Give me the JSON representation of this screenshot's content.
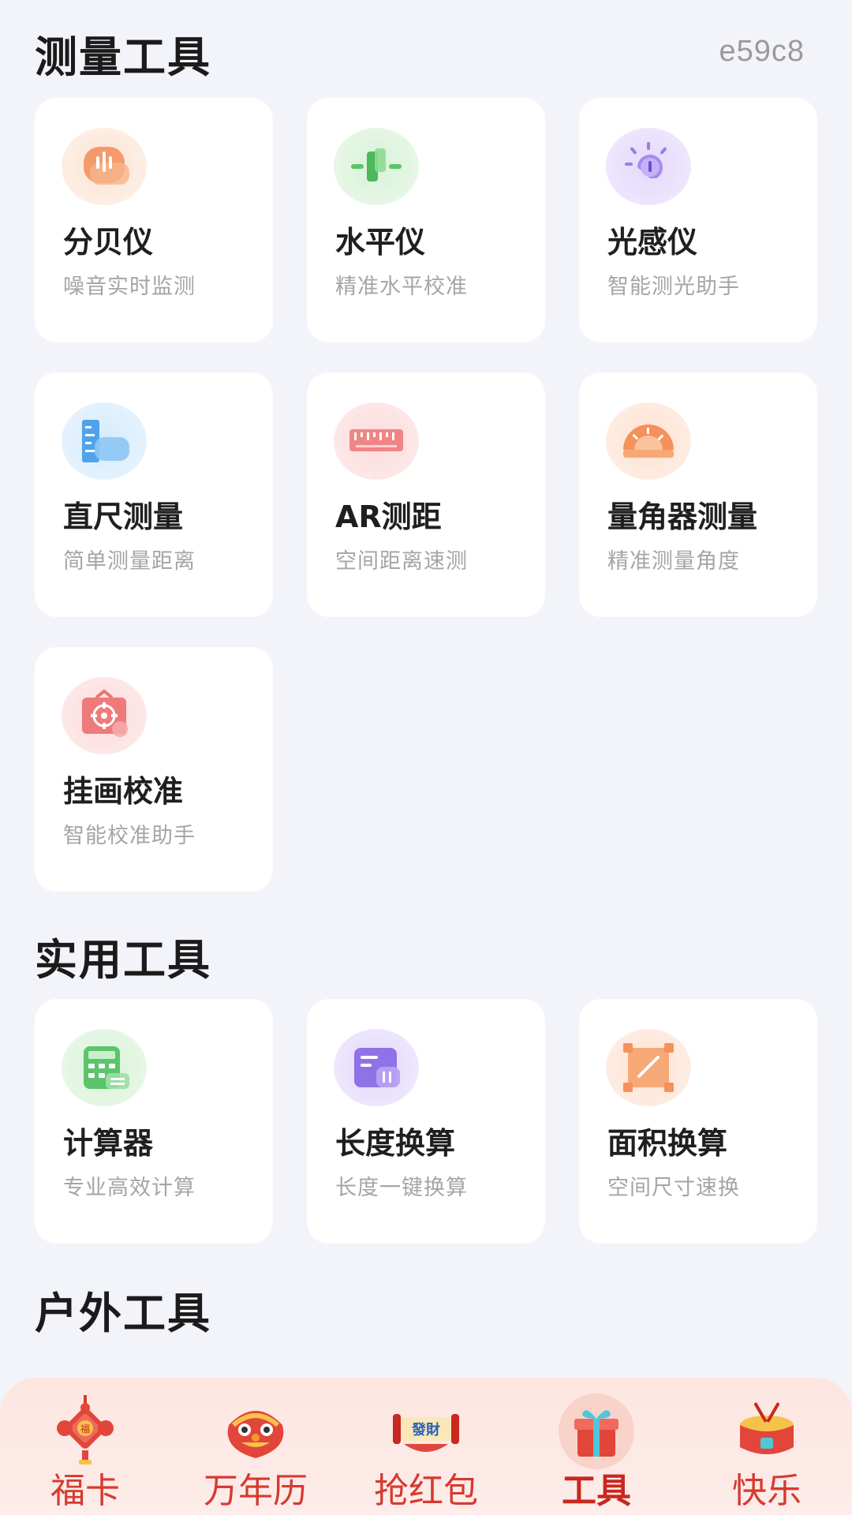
{
  "corner_code": "e59c8",
  "sections": {
    "measure": {
      "title": "测量工具",
      "cards": [
        {
          "name": "分贝仪",
          "desc": "噪音实时监测",
          "icon": "decibel-meter-icon"
        },
        {
          "name": "水平仪",
          "desc": "精准水平校准",
          "icon": "level-icon"
        },
        {
          "name": "光感仪",
          "desc": "智能测光助手",
          "icon": "light-sensor-icon"
        },
        {
          "name": "直尺测量",
          "desc": "简单测量距离",
          "icon": "ruler-icon"
        },
        {
          "name": "AR测距",
          "desc": "空间距离速测",
          "icon": "ar-tape-icon"
        },
        {
          "name": "量角器测量",
          "desc": "精准测量角度",
          "icon": "protractor-icon"
        },
        {
          "name": "挂画校准",
          "desc": "智能校准助手",
          "icon": "picture-align-icon"
        }
      ]
    },
    "practical": {
      "title": "实用工具",
      "cards": [
        {
          "name": "计算器",
          "desc": "专业高效计算",
          "icon": "calculator-icon"
        },
        {
          "name": "长度换算",
          "desc": "长度一键换算",
          "icon": "length-convert-icon"
        },
        {
          "name": "面积换算",
          "desc": "空间尺寸速换",
          "icon": "area-convert-icon"
        }
      ]
    },
    "outdoor": {
      "title": "户外工具"
    }
  },
  "nav": {
    "items": [
      {
        "label": "福卡",
        "icon": "chinese-knot-icon",
        "active": false
      },
      {
        "label": "万年历",
        "icon": "lion-head-icon",
        "active": false
      },
      {
        "label": "抢红包",
        "icon": "scroll-icon",
        "active": false
      },
      {
        "label": "工具",
        "icon": "gift-box-icon",
        "active": true
      },
      {
        "label": "快乐",
        "icon": "drum-icon",
        "active": false
      }
    ],
    "accent": "#d63a2f"
  }
}
